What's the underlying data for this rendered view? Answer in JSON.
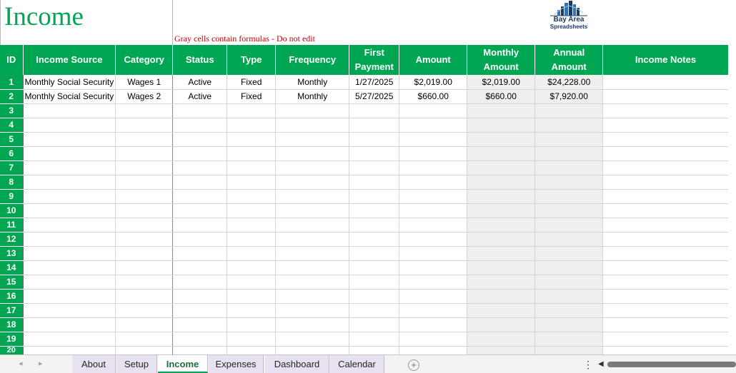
{
  "sheet": {
    "title": "Income",
    "note": "Gray cells contain formulas - Do not edit",
    "logo": {
      "line1": "Bay Area",
      "line2": "Spreadsheets"
    }
  },
  "columns": [
    {
      "key": "id",
      "label": "ID"
    },
    {
      "key": "source",
      "label": "Income Source"
    },
    {
      "key": "category",
      "label": "Category"
    },
    {
      "key": "status",
      "label": "Status"
    },
    {
      "key": "type",
      "label": "Type"
    },
    {
      "key": "frequency",
      "label": "Frequency"
    },
    {
      "key": "first_payment",
      "label": "First Payment"
    },
    {
      "key": "amount",
      "label": "Amount"
    },
    {
      "key": "monthly_amount",
      "label": "Monthly Amount"
    },
    {
      "key": "annual_amount",
      "label": "Annual Amount"
    },
    {
      "key": "notes",
      "label": "Income Notes"
    }
  ],
  "rows": [
    {
      "id": "1",
      "source": "Monthly Social Security",
      "category": "Wages 1",
      "status": "Active",
      "type": "Fixed",
      "frequency": "Monthly",
      "first_payment": "1/27/2025",
      "amount": "$2,019.00",
      "monthly_amount": "$2,019.00",
      "annual_amount": "$24,228.00",
      "notes": ""
    },
    {
      "id": "2",
      "source": "Monthly Social Security",
      "category": "Wages 2",
      "status": "Active",
      "type": "Fixed",
      "frequency": "Monthly",
      "first_payment": "5/27/2025",
      "amount": "$660.00",
      "monthly_amount": "$660.00",
      "annual_amount": "$7,920.00",
      "notes": ""
    },
    {
      "id": "3"
    },
    {
      "id": "4"
    },
    {
      "id": "5"
    },
    {
      "id": "6"
    },
    {
      "id": "7"
    },
    {
      "id": "8"
    },
    {
      "id": "9"
    },
    {
      "id": "10"
    },
    {
      "id": "11"
    },
    {
      "id": "12"
    },
    {
      "id": "13"
    },
    {
      "id": "14"
    },
    {
      "id": "15"
    },
    {
      "id": "16"
    },
    {
      "id": "17"
    },
    {
      "id": "18"
    },
    {
      "id": "19"
    },
    {
      "id": "20"
    }
  ],
  "tabs": [
    {
      "label": "About",
      "active": false
    },
    {
      "label": "Setup",
      "active": false
    },
    {
      "label": "Income",
      "active": true
    },
    {
      "label": "Expenses",
      "active": false
    },
    {
      "label": "Dashboard",
      "active": false
    },
    {
      "label": "Calendar",
      "active": false
    }
  ],
  "colors": {
    "header_green": "#00a651",
    "formula_gray": "#efefef",
    "note_red": "#c00000"
  },
  "icons": {
    "add_sheet": "plus-circle-icon",
    "more": "vertical-ellipsis-icon",
    "logo": "bay-area-spreadsheets-logo"
  }
}
